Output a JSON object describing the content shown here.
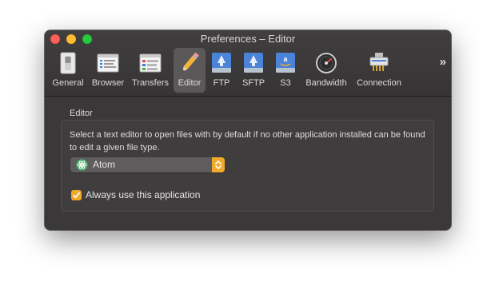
{
  "window": {
    "title": "Preferences – Editor"
  },
  "toolbar": {
    "items": [
      {
        "label": "General",
        "icon": "switch-icon",
        "selected": false
      },
      {
        "label": "Browser",
        "icon": "browser-window-icon",
        "selected": false
      },
      {
        "label": "Transfers",
        "icon": "transfers-list-icon",
        "selected": false
      },
      {
        "label": "Editor",
        "icon": "pencil-icon",
        "selected": true
      },
      {
        "label": "FTP",
        "icon": "ftp-drive-icon",
        "selected": false
      },
      {
        "label": "SFTP",
        "icon": "sftp-drive-icon",
        "selected": false
      },
      {
        "label": "S3",
        "icon": "s3-drive-icon",
        "selected": false
      },
      {
        "label": "Bandwidth",
        "icon": "gauge-icon",
        "selected": false
      },
      {
        "label": "Connection",
        "icon": "network-connector-icon",
        "selected": false
      }
    ],
    "more": "»"
  },
  "editor": {
    "group_label": "Editor",
    "description": "Select a text editor to open files with by default if no other application installed can be found to edit a given file type.",
    "selected_editor": "Atom",
    "checkbox_label": "Always use this application",
    "checkbox_checked": true
  },
  "colors": {
    "accent": "#f0a92b",
    "window_bg": "#3a3838",
    "selected_toolbar_bg": "#5a5858"
  }
}
